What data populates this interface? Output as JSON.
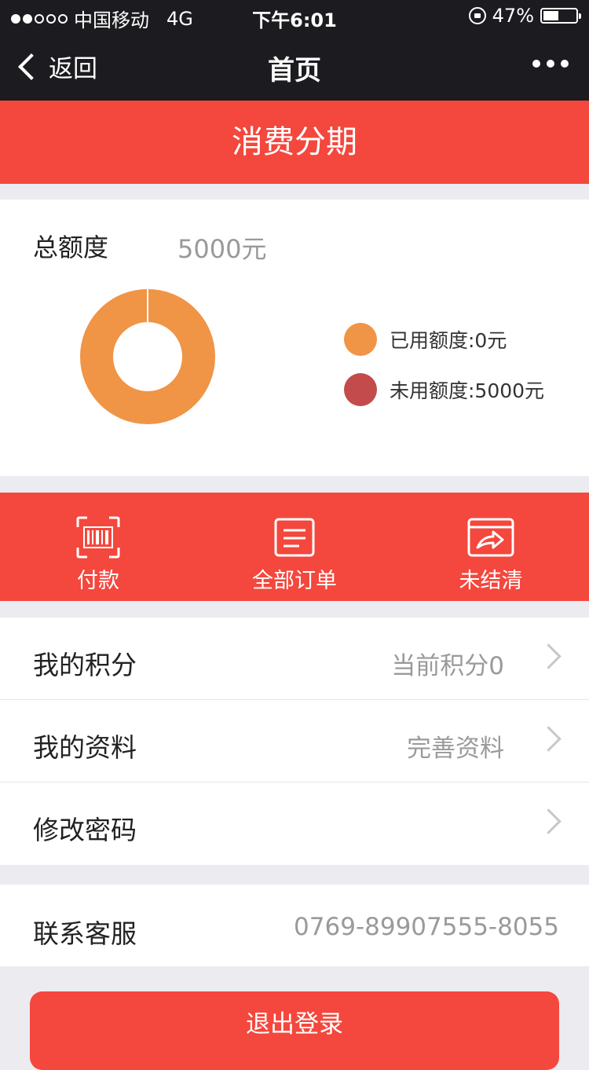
{
  "status_bar": {
    "carrier": "中国移动",
    "network": "4G",
    "time": "下午6:01",
    "battery": "47%",
    "battery_level": 0.47
  },
  "nav": {
    "back_label": "返回",
    "title": "首页"
  },
  "banner": {
    "title": "消费分期"
  },
  "credit": {
    "total_label": "总额度",
    "total_value": "5000元",
    "used_label": "已用额度:0元",
    "unused_label": "未用额度:5000元",
    "used_amount": 0,
    "unused_amount": 5000,
    "used_color": "#f09446",
    "unused_color": "#c34b4b"
  },
  "actions": [
    {
      "label": "付款",
      "icon": "barcode-scan-icon"
    },
    {
      "label": "全部订单",
      "icon": "order-list-icon"
    },
    {
      "label": "未结清",
      "icon": "card-arrow-icon"
    }
  ],
  "menu": {
    "points": {
      "label": "我的积分",
      "value": "当前积分0"
    },
    "profile": {
      "label": "我的资料",
      "value": "完善资料"
    },
    "password": {
      "label": "修改密码",
      "value": ""
    }
  },
  "contact": {
    "label": "联系客服",
    "phone": "0769-89907555-8055"
  },
  "logout_label": "退出登录",
  "colors": {
    "accent": "#f4473d",
    "navbar": "#1c1c20"
  }
}
